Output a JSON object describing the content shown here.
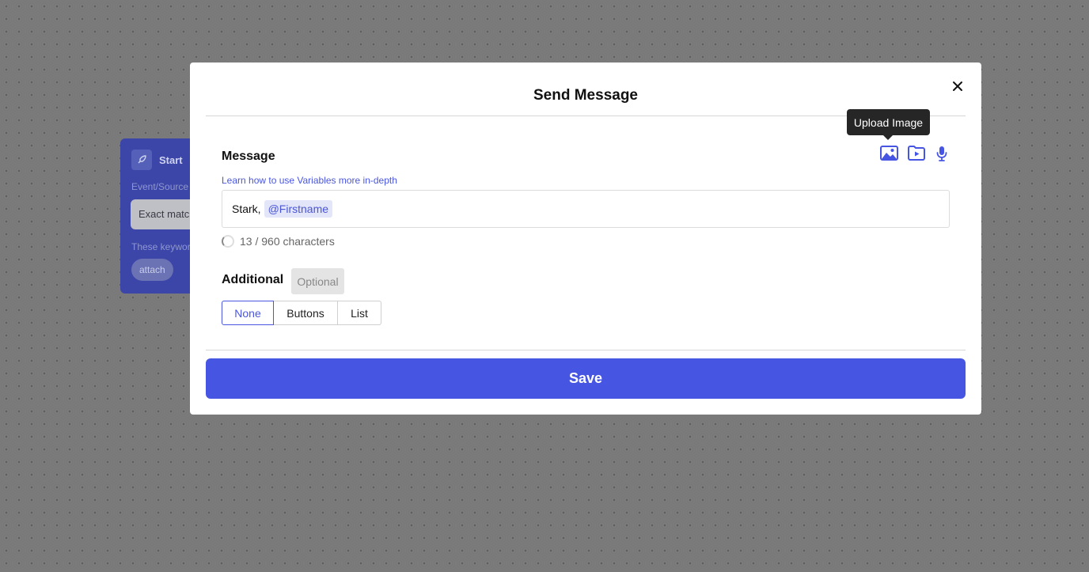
{
  "background_node": {
    "title": "Start",
    "event_label": "Event/Source",
    "match_value": "Exact match",
    "help_text": "These keywords",
    "tag": "attach"
  },
  "modal": {
    "title": "Send Message",
    "message_label": "Message",
    "variables_link": "Learn how to use Variables more in-depth",
    "tooltip": "Upload Image",
    "message": {
      "text": "Stark,",
      "variable": "@Firstname"
    },
    "counter": "13 / 960 characters",
    "additional_label": "Additional",
    "optional_badge": "Optional",
    "options": [
      "None",
      "Buttons",
      "List"
    ],
    "selected_option": "None",
    "save_label": "Save"
  },
  "icons": {
    "close": "close-icon",
    "image": "image-icon",
    "video": "video-folder-icon",
    "audio": "microphone-icon",
    "node": "rocket-icon"
  },
  "colors": {
    "accent": "#4755e3",
    "link": "#4a56e2",
    "chip_bg": "#e3e5f9",
    "tooltip_bg": "#262626",
    "node_bg": "#3c46a8"
  }
}
